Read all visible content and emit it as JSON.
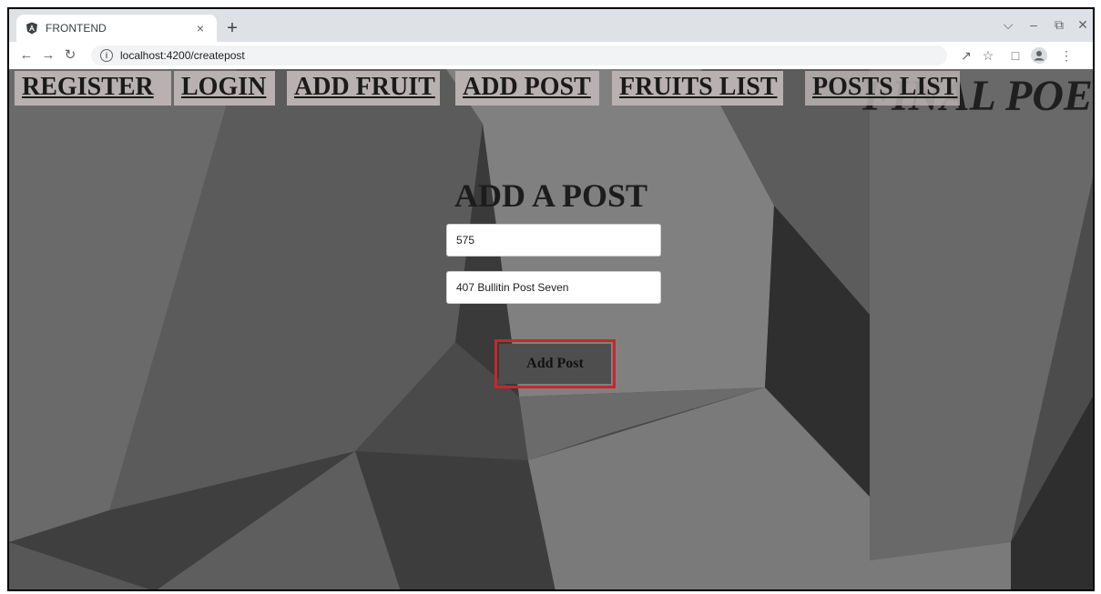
{
  "browser": {
    "tab_title": "FRONTEND",
    "tab_close": "×",
    "new_tab": "+",
    "url": "localhost:4200/createpost",
    "icons": [
      "back-arrow-icon",
      "forward-arrow-icon",
      "reload-icon",
      "info-icon",
      "share-icon",
      "star-icon",
      "sidebar-icon",
      "profile-icon",
      "menu-icon"
    ]
  },
  "nav": {
    "links": [
      "REGISTER",
      "LOGIN",
      "ADD FRUIT",
      "ADD POST",
      "FRUITS LIST",
      "POSTS LIST"
    ],
    "brand": "FINAL POE"
  },
  "form": {
    "title": "ADD A POST",
    "field1_value": "575",
    "field2_value": "407 Bullitin Post Seven",
    "submit_label": "Add Post"
  },
  "colors": {
    "nav_button_bg": "#b9b1b1",
    "highlight": "#c9262c"
  }
}
